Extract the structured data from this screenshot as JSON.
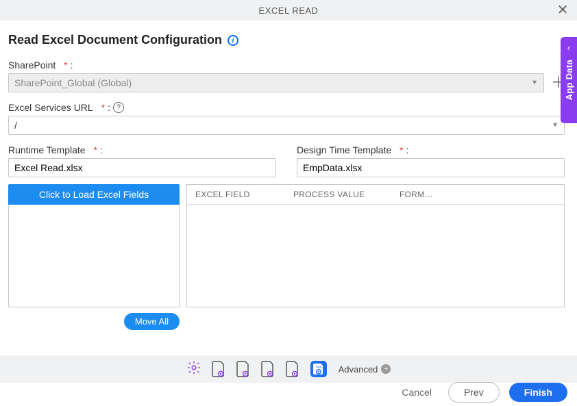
{
  "titlebar": {
    "title": "EXCEL READ"
  },
  "page": {
    "heading": "Read Excel Document Configuration"
  },
  "sharepoint": {
    "label": "SharePoint",
    "value": "SharePoint_Global (Global)"
  },
  "excel_services": {
    "label": "Excel Services URL",
    "value": "/"
  },
  "runtime_template": {
    "label": "Runtime Template",
    "value": "Excel Read.xlsx"
  },
  "design_template": {
    "label": "Design Time Template",
    "value": "EmpData.xlsx"
  },
  "buttons": {
    "load_fields": "Click to Load Excel Fields",
    "move_all": "Move All",
    "cancel": "Cancel",
    "prev": "Prev",
    "finish": "Finish"
  },
  "table": {
    "col1": "EXCEL FIELD",
    "col2": "PROCESS VALUE",
    "col3": "FORM…"
  },
  "bottom": {
    "advanced": "Advanced"
  },
  "side": {
    "label": "App Data"
  },
  "required_marker": "*",
  "colon": ":"
}
